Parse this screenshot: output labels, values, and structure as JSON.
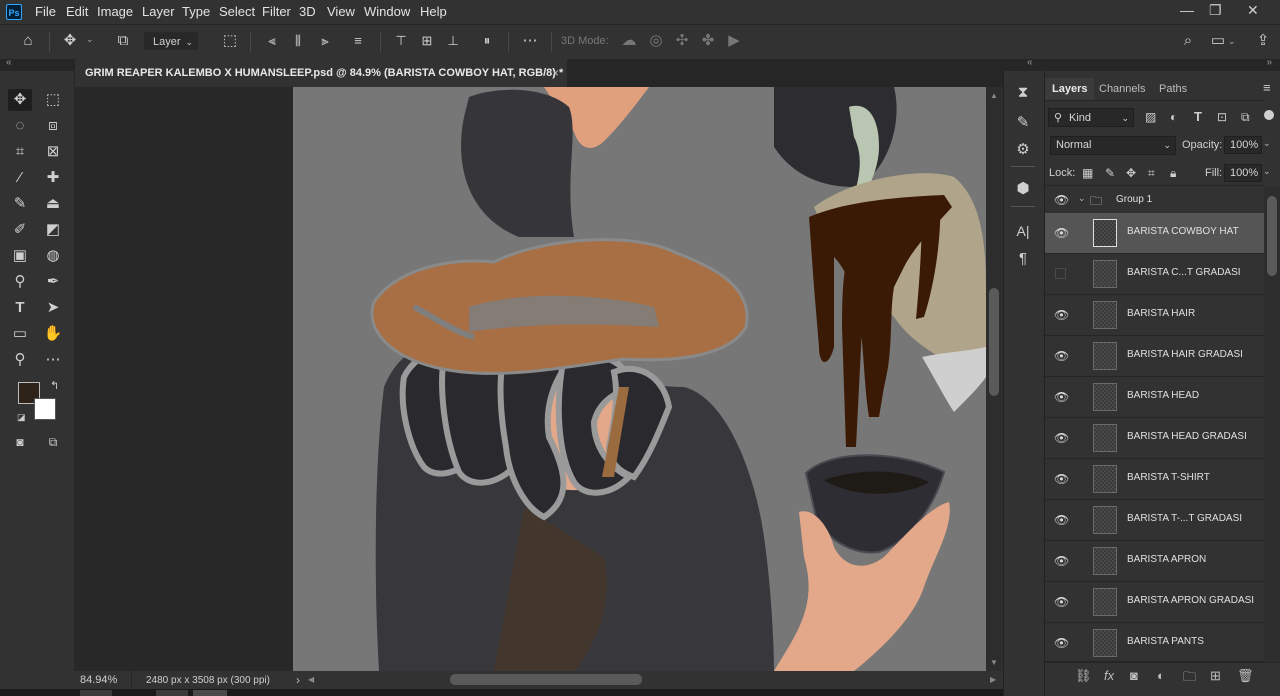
{
  "app": {
    "logo": "Ps"
  },
  "menu": [
    "File",
    "Edit",
    "Image",
    "Layer",
    "Type",
    "Select",
    "Filter",
    "3D",
    "View",
    "Window",
    "Help"
  ],
  "window_controls": {
    "minimize": "—",
    "restore": "❐",
    "close": "✕"
  },
  "options_bar": {
    "auto_select_target": "Layer",
    "mode_3d_label": "3D Mode:"
  },
  "document": {
    "tab_title": "GRIM REAPER KALEMBO X HUMANSLEEP.psd @ 84.9% (BARISTA COWBOY HAT, RGB/8) *",
    "close_glyph": "×",
    "zoom": "84.94%",
    "dimensions": "2480 px x 3508 px (300 ppi)",
    "status_arrow": "›"
  },
  "colors": {
    "foreground": "#2e231b",
    "background": "#ffffff",
    "canvas_bg": "#777777"
  },
  "panel": {
    "tabs": [
      "Layers",
      "Channels",
      "Paths"
    ],
    "filter_kind": "Kind",
    "blend_mode": "Normal",
    "opacity_label": "Opacity:",
    "opacity_value": "100%",
    "lock_label": "Lock:",
    "fill_label": "Fill:",
    "fill_value": "100%",
    "group_name": "Group 1",
    "layers": [
      {
        "name": "BARISTA COWBOY HAT",
        "visible": true,
        "selected": true
      },
      {
        "name": "BARISTA C...T GRADASI",
        "visible": false,
        "selected": false
      },
      {
        "name": "BARISTA HAIR",
        "visible": true,
        "selected": false
      },
      {
        "name": "BARISTA HAIR GRADASI",
        "visible": true,
        "selected": false
      },
      {
        "name": "BARISTA HEAD",
        "visible": true,
        "selected": false
      },
      {
        "name": "BARISTA HEAD GRADASI",
        "visible": true,
        "selected": false
      },
      {
        "name": "BARISTA T-SHIRT",
        "visible": true,
        "selected": false
      },
      {
        "name": "BARISTA T-...T GRADASI",
        "visible": true,
        "selected": false
      },
      {
        "name": "BARISTA APRON",
        "visible": true,
        "selected": false
      },
      {
        "name": "BARISTA APRON GRADASI",
        "visible": true,
        "selected": false
      },
      {
        "name": "BARISTA PANTS",
        "visible": true,
        "selected": false
      }
    ]
  },
  "mid_dock": {
    "type_label": "A|",
    "paragraph_label": "¶"
  }
}
